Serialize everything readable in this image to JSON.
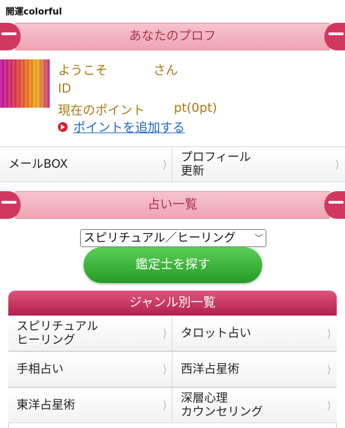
{
  "site": {
    "title": "開運colorful"
  },
  "profile_section": {
    "title": "あなたのプロフ"
  },
  "profile": {
    "welcome": "ようこそ",
    "honorific": "さん",
    "id_label": "ID",
    "points_label": "現在のポイント",
    "points_value": "pt(0pt)",
    "add_points": "ポイントを追加する"
  },
  "menu": {
    "mail_box": "メールBOX",
    "profile_update": "プロフィール\n更新"
  },
  "fortune_section": {
    "title": "占い一覧"
  },
  "search": {
    "selected": "スピリチュアル／ヒーリング",
    "button": "鑑定士を探す"
  },
  "genres": {
    "title": "ジャンル別一覧",
    "items": [
      "スピリチュアル\nヒーリング",
      "タロット占い",
      "手相占い",
      "西洋占星術",
      "東洋占星術",
      "深層心理\nカウンセリング"
    ]
  },
  "icons": {
    "chevron": "chevron-right-icon",
    "bullet": "arrow-bullet-icon"
  },
  "colors": {
    "ribbon": "#eea5b4",
    "ribbon_text": "#a8334e",
    "gold_text": "#a87a12",
    "link": "#1b66c9",
    "button_green": "#249a26",
    "genre_header": "#b41f4e"
  }
}
